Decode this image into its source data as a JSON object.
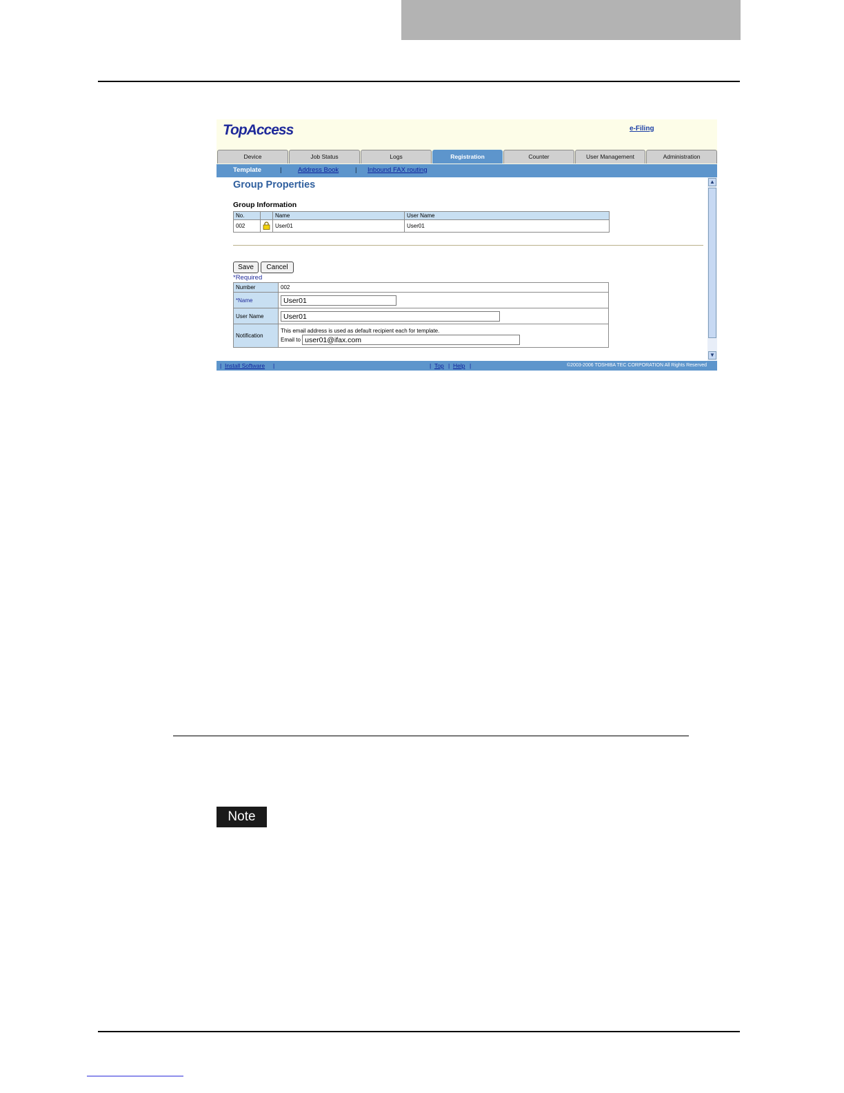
{
  "header": {
    "logo": "TopAccess",
    "efiling_link": "e-Filing"
  },
  "tabs": [
    "Device",
    "Job Status",
    "Logs",
    "Registration",
    "Counter",
    "User Management",
    "Administration"
  ],
  "active_tab": "Registration",
  "subnav": {
    "current": "Template",
    "sep": "|",
    "links": [
      "Address Book",
      "Inbound FAX routing"
    ]
  },
  "page_title": "Group Properties",
  "group_info": {
    "title": "Group Information",
    "columns": [
      "No.",
      "",
      "Name",
      "User Name"
    ],
    "row": {
      "no": "002",
      "lock_icon": "lock-icon",
      "name": "User01",
      "user_name": "User01"
    }
  },
  "buttons": {
    "save": "Save",
    "cancel": "Cancel"
  },
  "required_note": "*Required",
  "form": {
    "number_label": "Number",
    "number_value": "002",
    "name_label": "*Name",
    "name_value": "User01",
    "username_label": "User Name",
    "username_value": "User01",
    "notification_label": "Notification",
    "notification_text": "This email address is used as default recipient each for template.",
    "email_label": "Email to",
    "email_value": "user01@ifax.com"
  },
  "footer": {
    "install": "Install Software",
    "top": "Top",
    "help": "Help",
    "sep": "|",
    "copyright": "©2003-2006 TOSHIBA TEC CORPORATION All Rights Reserved"
  },
  "note_badge": "Note",
  "colors": {
    "tab_active": "#5d95cc",
    "header_bg": "#fdfde8",
    "title": "#2f5f9e",
    "label_bg": "#c8dff2"
  }
}
